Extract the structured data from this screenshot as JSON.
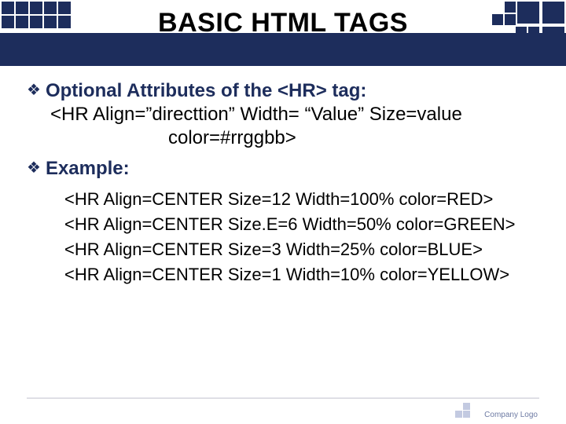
{
  "title": "BASIC HTML TAGS",
  "bullets": {
    "list_title": "Optional Attributes of the <HR> tag:",
    "example_title": "Example:"
  },
  "syntax": {
    "line1": "<HR Align=”directtion” Width= “Value” Size=value",
    "line2": "color=#rrggbb>"
  },
  "examples": [
    "<HR Align=CENTER Size=12 Width=100% color=RED>",
    "<HR Align=CENTER Size.E=6 Width=50% color=GREEN>",
    "<HR Align=CENTER Size=3 Width=25% color=BLUE>",
    "<HR Align=CENTER Size=1 Width=10% color=YELLOW>"
  ],
  "footer": "Company Logo"
}
